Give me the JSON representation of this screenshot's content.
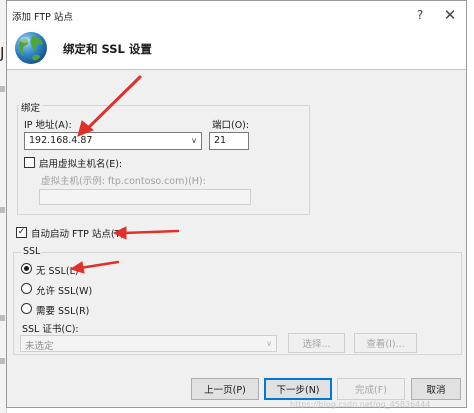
{
  "background_app": {
    "visible_char": "J"
  },
  "window": {
    "title": "添加 FTP 站点",
    "help_glyph": "?",
    "close_glyph": "✕"
  },
  "banner": {
    "heading": "绑定和 SSL 设置"
  },
  "binding": {
    "group_label": "绑定",
    "ip_label": "IP 地址(A):",
    "ip_value": "192.168.4.87",
    "port_label": "端口(O):",
    "port_value": "21",
    "vhost_checkbox_label": "启用虚拟主机名(E):",
    "vhost_checked": false,
    "vhost_field_label": "虚拟主机(示例: ftp.contoso.com)(H):",
    "vhost_value": ""
  },
  "autostart": {
    "label": "自动启动 FTP 站点(T)",
    "checked": true
  },
  "ssl": {
    "group_label": "SSL",
    "options": [
      {
        "label": "无 SSL(L)",
        "selected": true
      },
      {
        "label": "允许 SSL(W)",
        "selected": false
      },
      {
        "label": "需要 SSL(R)",
        "selected": false
      }
    ],
    "cert_label": "SSL 证书(C):",
    "cert_value": "未选定",
    "select_button": "选择...",
    "view_button": "查看(I)..."
  },
  "footer": {
    "prev_button": "上一页(P)",
    "next_button": "下一步(N)",
    "finish_button": "完成(F)",
    "cancel_button": "取消"
  },
  "watermark": "https://blog.csdn.net/qq_45836444",
  "colors": {
    "annotation_arrow": "#e0302a",
    "default_button_border": "#0078d7"
  }
}
